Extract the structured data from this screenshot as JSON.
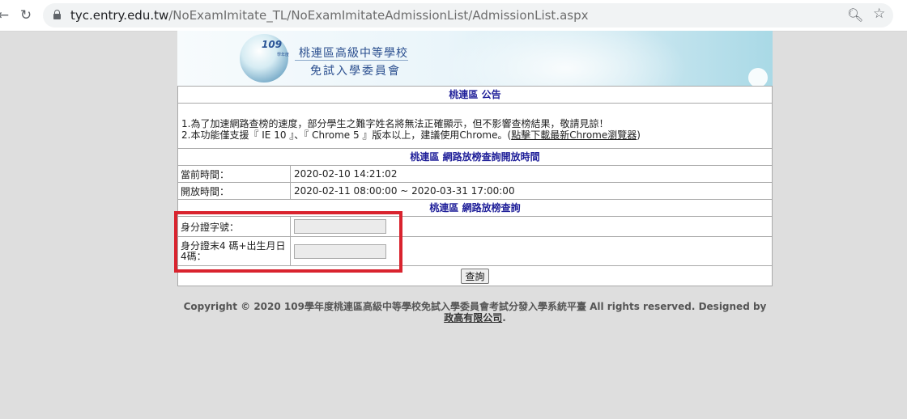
{
  "browser": {
    "url_host": "tyc.entry.edu.tw",
    "url_path": "/NoExamImitate_TL/NoExamImitateAdmissionList/AdmissionList.aspx"
  },
  "banner": {
    "logo_number": "109",
    "logo_sub": "學年度",
    "title_line1": "桃連區高級中等學校",
    "title_line2": "免試入學委員會"
  },
  "announcement": {
    "title": "桃連區 公告",
    "line1": "1.為了加速網路查榜的速度，部分學生之難字姓名將無法正確顯示，但不影響查榜結果，敬請見諒！",
    "line2_prefix": "2.本功能僅支援『 IE 10 』、『 Chrome 5 』版本以上，建議使用Chrome。(",
    "line2_link": "點擊下載最新Chrome瀏覽器",
    "line2_suffix": ")"
  },
  "open_time": {
    "title": "桃連區 網路放榜查詢開放時間",
    "current_label": "當前時間：",
    "current_value": "2020-02-10 14:21:02",
    "open_label": "開放時間：",
    "open_value": "2020-02-11 08:00:00 ~ 2020-03-31 17:00:00"
  },
  "query": {
    "title": "桃連區 網路放榜查詢",
    "id_label": "身分證字號：",
    "id_value": "",
    "code_label": "身分證末4 碼+出生月日4碼：",
    "code_value": "",
    "button_label": "查詢"
  },
  "footer": {
    "text": "Copyright © 2020 109學年度桃連區高級中等學校免試入學委員會考試分發入學系統平臺 All rights reserved. Designed by ",
    "link": "政高有限公司",
    "suffix": "."
  },
  "colors": {
    "highlight": "#d9232e",
    "section_title": "#1f1f99"
  }
}
